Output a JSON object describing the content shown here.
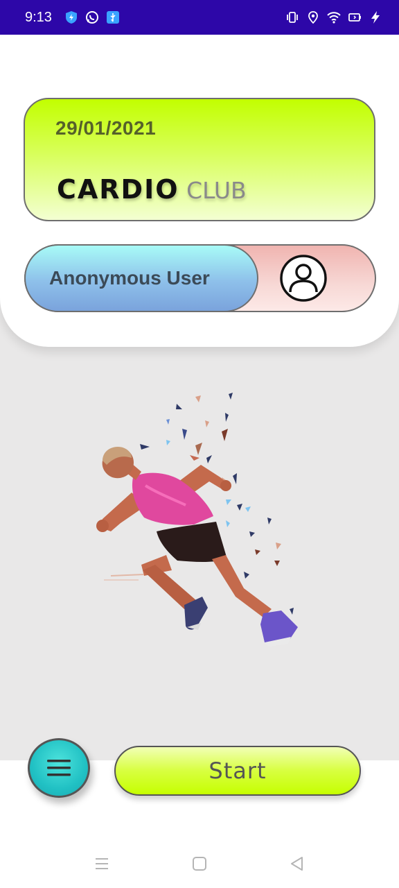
{
  "status_bar": {
    "time": "9:13",
    "left_icons": [
      "shield-bolt-icon",
      "whatsapp-icon",
      "usb-icon"
    ],
    "right_icons": [
      "vibrate-icon",
      "location-icon",
      "wifi-icon",
      "battery-icon",
      "charging-icon"
    ]
  },
  "header": {
    "date": "29/01/2021",
    "title_main": "CARDIO",
    "title_sub": "CLUB"
  },
  "user": {
    "name": "Anonymous User",
    "avatar_icon": "user-avatar-icon"
  },
  "illustration": {
    "icon": "runner-illustration"
  },
  "actions": {
    "menu_icon": "hamburger-menu-icon",
    "start_label": "Start"
  },
  "navigation": {
    "icons": [
      "recents-icon",
      "home-icon",
      "back-icon"
    ]
  },
  "colors": {
    "status_bar": "#2d07a8",
    "date_card": "#c2ff00",
    "user_pill_left": "#8ec0ea",
    "user_pill_right": "#f0b4b0",
    "menu_button": "#21c1c4",
    "start_button": "#c6ff00"
  }
}
